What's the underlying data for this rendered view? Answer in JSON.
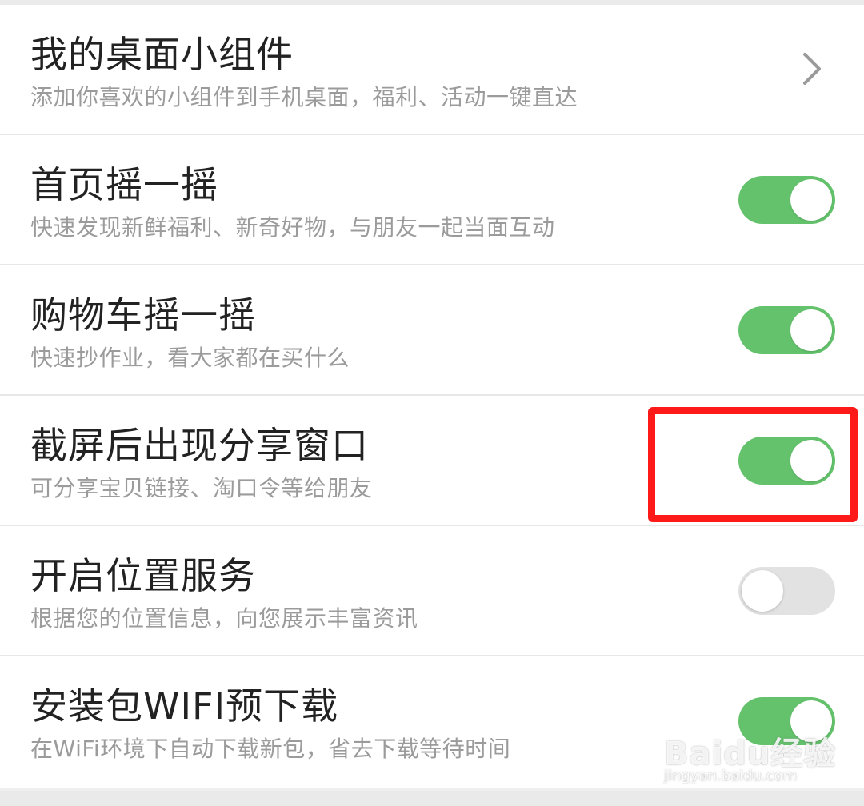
{
  "settings": [
    {
      "title": "我的桌面小组件",
      "subtitle": "添加你喜欢的小组件到手机桌面，福利、活动一键直达",
      "control": "chevron",
      "icon": "chevron-right-icon"
    },
    {
      "title": "首页摇一摇",
      "subtitle": "快速发现新鲜福利、新奇好物，与朋友一起当面互动",
      "control": "toggle",
      "enabled": true
    },
    {
      "title": "购物车摇一摇",
      "subtitle": "快速抄作业，看大家都在买什么",
      "control": "toggle",
      "enabled": true
    },
    {
      "title": "截屏后出现分享窗口",
      "subtitle": "可分享宝贝链接、淘口令等给朋友",
      "control": "toggle",
      "enabled": true,
      "highlighted": true
    },
    {
      "title": "开启位置服务",
      "subtitle": "根据您的位置信息，向您展示丰富资讯",
      "control": "toggle",
      "enabled": false
    },
    {
      "title": "安装包WIFI预下载",
      "subtitle": "在WiFi环境下自动下载新包，省去下载等待时间",
      "control": "toggle",
      "enabled": true
    }
  ],
  "colors": {
    "toggle_on": "#63c26b",
    "toggle_off": "#e2e2e2",
    "highlight": "#ff1a1a",
    "title_text": "#222222",
    "subtitle_text": "#9b9b9b"
  },
  "watermark": {
    "logo": "Baidu经验",
    "url": "jingyan.baidu.com"
  }
}
